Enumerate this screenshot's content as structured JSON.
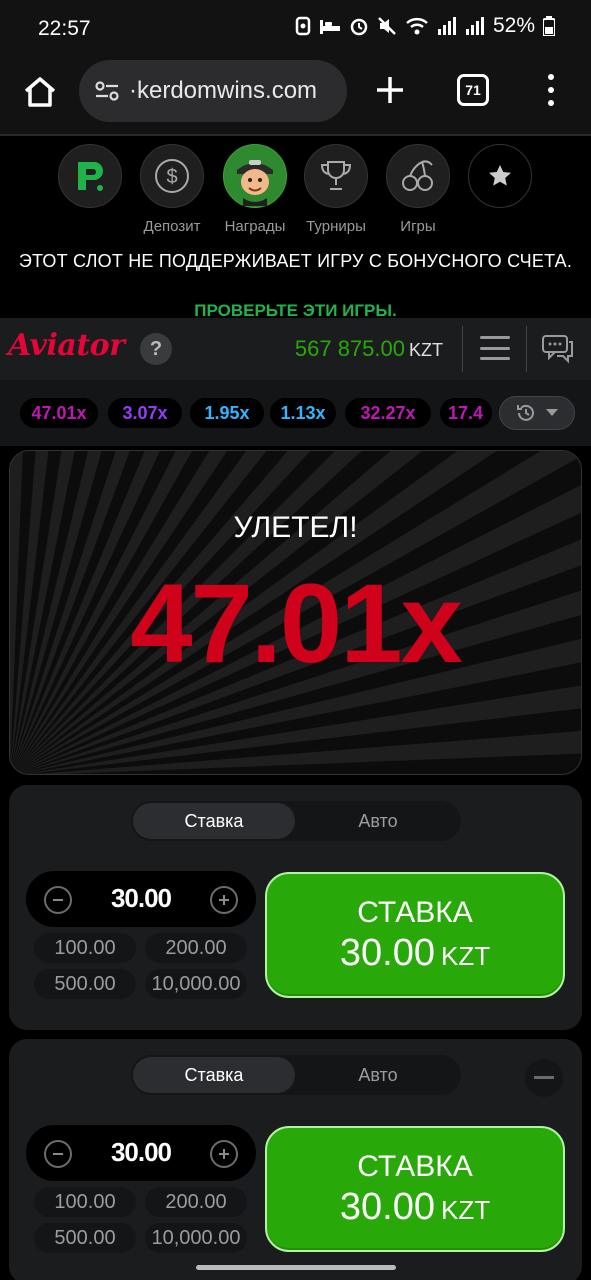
{
  "status_bar": {
    "time": "22:57",
    "battery": "52%"
  },
  "browser": {
    "url": "·kerdomwins.com",
    "tab_count": "71"
  },
  "site_nav": {
    "items": [
      {
        "label": ""
      },
      {
        "label": "Депозит"
      },
      {
        "label": "Награды"
      },
      {
        "label": "Турниры"
      },
      {
        "label": "Игры"
      },
      {
        "label": ""
      }
    ],
    "notice": "ЭТОТ СЛОТ НЕ ПОДДЕРЖИВАЕТ ИГРУ С БОНУСНОГО СЧЕТА.",
    "notice_link": "ПРОВЕРЬТЕ ЭТИ ИГРЫ."
  },
  "game_header": {
    "logo": "Aviator",
    "help": "?",
    "balance": "567 875.00",
    "currency": "KZT"
  },
  "history": {
    "multipliers": [
      {
        "value": "47.01x",
        "color": "#c017b4"
      },
      {
        "value": "3.07x",
        "color": "#913ef8"
      },
      {
        "value": "1.95x",
        "color": "#34b4ff"
      },
      {
        "value": "1.13x",
        "color": "#34b4ff"
      },
      {
        "value": "32.27x",
        "color": "#c017b4"
      },
      {
        "value": "17.4",
        "color": "#c017b4"
      }
    ]
  },
  "round": {
    "status": "УЛЕТЕЛ!",
    "multiplier": "47.01x"
  },
  "bet_panels": [
    {
      "tab_bet": "Ставка",
      "tab_auto": "Авто",
      "amount": "30.00",
      "quick": [
        "100.00",
        "200.00",
        "500.00",
        "10,000.00"
      ],
      "button_label": "СТАВКА",
      "button_amount": "30.00",
      "button_currency": "KZT"
    },
    {
      "tab_bet": "Ставка",
      "tab_auto": "Авто",
      "amount": "30.00",
      "quick": [
        "100.00",
        "200.00",
        "500.00",
        "10,000.00"
      ],
      "button_label": "СТАВКА",
      "button_amount": "30.00",
      "button_currency": "KZT"
    }
  ],
  "colors": {
    "brand_red": "#e50539",
    "accent_green": "#28a909",
    "crash_red": "#d0021b"
  }
}
